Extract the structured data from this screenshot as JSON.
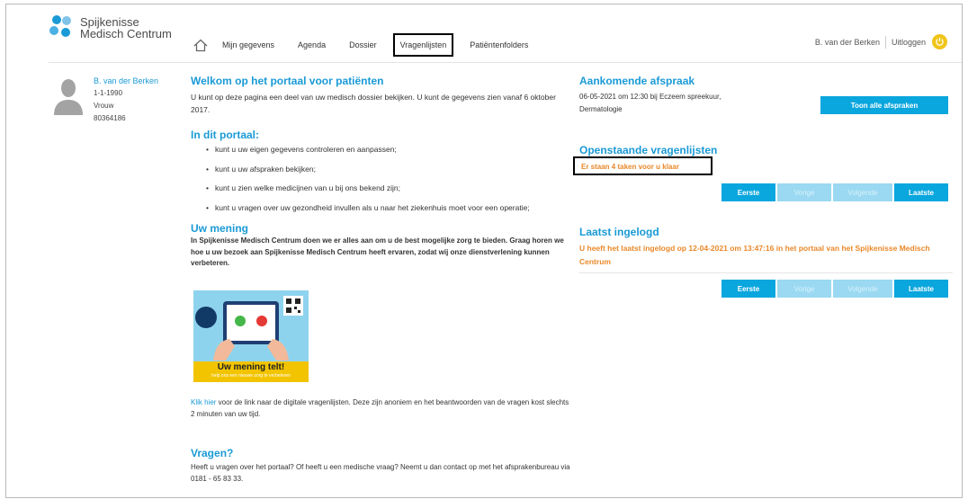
{
  "brand": {
    "line1": "Spijkenisse",
    "line2": "Medisch Centrum",
    "colors": {
      "accent": "#1a9ad6",
      "button": "#0aa6de",
      "orange": "#e9882a",
      "yellow": "#f0c419"
    }
  },
  "nav": {
    "home_icon": "home-icon",
    "items": [
      "Mijn gegevens",
      "Agenda",
      "Dossier",
      "Vragenlijsten",
      "Patiëntenfolders"
    ],
    "active": "Vragenlijsten"
  },
  "user_nav": {
    "name": "B. van der Berken",
    "logout": "Uitloggen",
    "logout_icon": "power-icon"
  },
  "patient": {
    "name": "B. van der Berken",
    "dob": "1-1-1990",
    "gender": "Vrouw",
    "id": "80364186",
    "avatar_icon": "user-silhouette-icon"
  },
  "welcome": {
    "title": "Welkom op het portaal voor patiënten",
    "text": "U kunt op deze pagina een deel van uw medisch dossier bekijken. U kunt de gegevens zien vanaf 6 oktober 2017."
  },
  "portal": {
    "title": "In dit portaal:",
    "items": [
      "kunt u uw eigen gegevens controleren en aanpassen;",
      "kunt u uw afspraken bekijken;",
      "kunt u zien welke medicijnen van u bij ons bekend zijn;",
      "kunt u vragen over uw gezondheid invullen als u naar het ziekenhuis moet voor een operatie;"
    ]
  },
  "opinion": {
    "title": "Uw mening",
    "text": "In Spijkenisse Medisch Centrum doen we er alles aan om u de best mogelijke zorg te bieden. Graag horen we hoe u uw bezoek aan Spijkenisse Medisch Centrum heeft ervaren, zodat wij onze dienstverlening kunnen verbeteren.",
    "promo_title": "Uw mening telt!",
    "promo_sub": "help ons een nieuwe zorg te verbeteren",
    "link": "Klik hier",
    "link_text": " voor de link naar de digitale vragenlijsten. Deze zijn anoniem en het beantwoorden van de vragen kost slechts 2 minuten van uw tijd."
  },
  "questions": {
    "title": "Vragen?",
    "text": "Heeft u vragen over het portaal? Of heeft u een medische vraag? Neemt u dan contact op met het afsprakenbureau via 0181 - 65 83 33."
  },
  "appointment": {
    "title": "Aankomende afspraak",
    "line1": "06-05-2021 om 12:30 bij Eczeem spreekuur,",
    "line2": "Dermatologie",
    "button": "Toon alle afspraken"
  },
  "questionnaires": {
    "title": "Openstaande vragenlijsten",
    "status": "Er staan 4 taken voor u klaar",
    "pager": [
      "Eerste",
      "Vorige",
      "Volgende",
      "Laatste"
    ]
  },
  "last_login": {
    "title": "Laatst ingelogd",
    "text": "U heeft het laatst ingelogd op 12-04-2021 om 13:47:16 in het portaal van het Spijkenisse Medisch Centrum",
    "pager": [
      "Eerste",
      "Vorige",
      "Volgende",
      "Laatste"
    ]
  }
}
